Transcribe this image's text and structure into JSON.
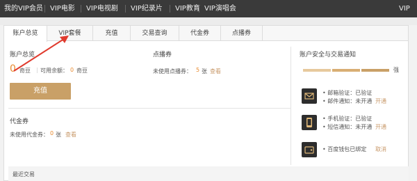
{
  "topnav": {
    "items": [
      "我的VIP会员",
      "VIP电影",
      "VIP电视剧",
      "VIP纪录片",
      "VIP教育",
      "VIP演唱会"
    ],
    "right_label": "VIP"
  },
  "tabs": [
    "账户总览",
    "VIP套餐",
    "充值",
    "交易查询",
    "代金券",
    "点播券"
  ],
  "account": {
    "title": "账户总览",
    "balance": "0",
    "unit": "奇豆",
    "available_label": "可用余额：",
    "available_value": "0",
    "available_unit": "奇豆",
    "recharge_button": "充值"
  },
  "vod": {
    "title": "点播券",
    "unused_label": "未使用点播券：",
    "count": "5",
    "unit": "张",
    "view_link": "查看"
  },
  "voucher": {
    "title": "代金券",
    "unused_label": "未使用代金券：",
    "count": "0",
    "unit": "张",
    "view_link": "查看"
  },
  "security": {
    "title": "账户安全与交易通知",
    "level_label": "强",
    "email_verify": "邮箱验证：已验证",
    "email_notify": "邮件通知：未开通",
    "email_action": "开通",
    "phone_verify": "手机验证：已验证",
    "sms_notify": "短信通知：未开通",
    "sms_action": "开通",
    "wallet_text": "百度钱包已绑定",
    "wallet_action": "取消"
  },
  "recent": {
    "title": "最近交易"
  },
  "icons": {
    "email": "mail-icon",
    "phone": "phone-icon",
    "wallet": "wallet-icon",
    "arrow": "red-arrow-annotation"
  },
  "colors": {
    "nav_bg": "#3a3a3a",
    "accent_gold": "#c9a067",
    "orange": "#e88a2e",
    "annotation_red": "#e03b2e"
  }
}
